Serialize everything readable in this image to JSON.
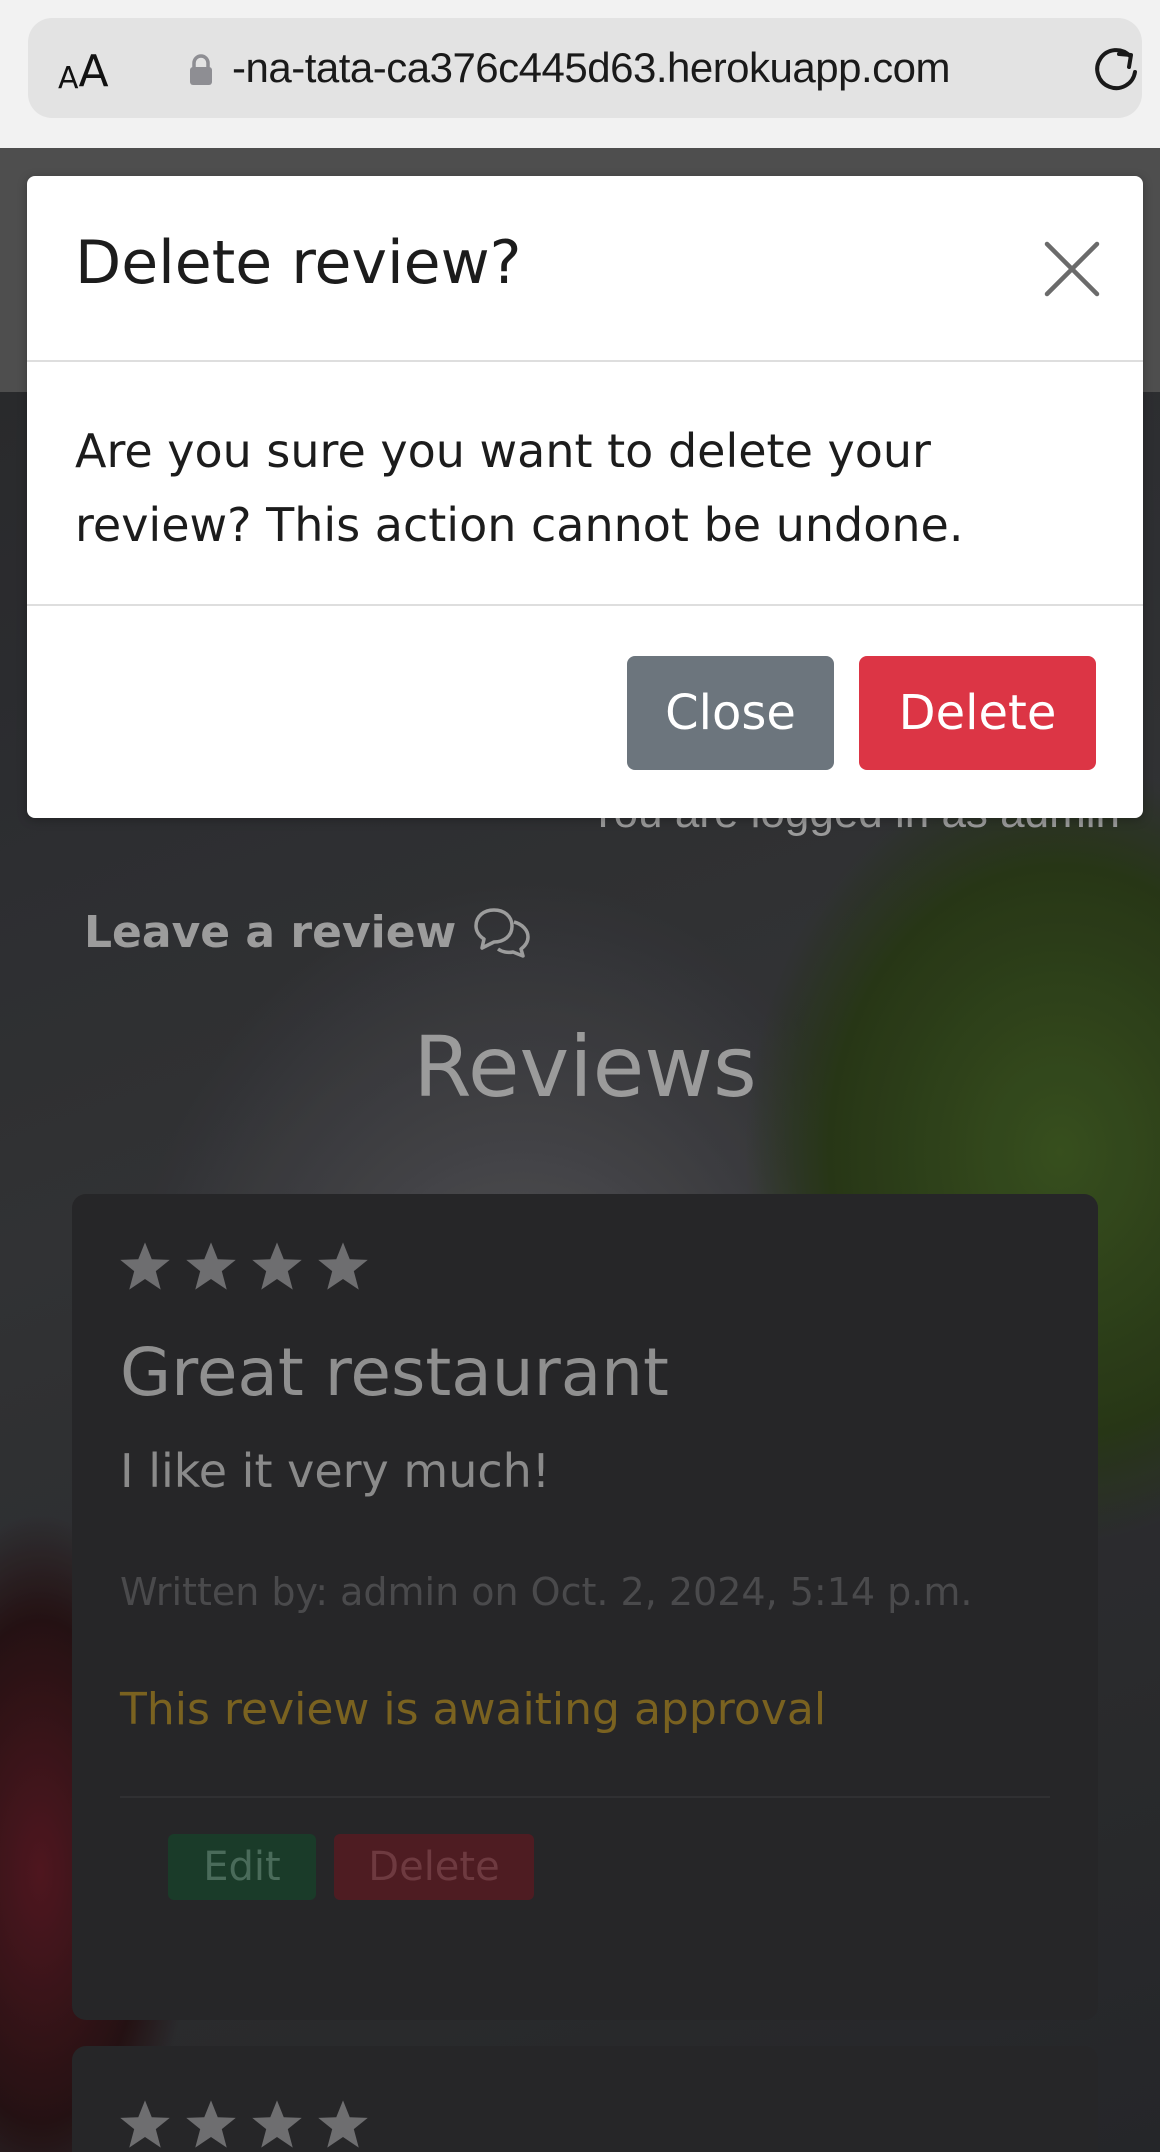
{
  "browser": {
    "text_size_small": "A",
    "text_size_large": "A",
    "url": "-na-tata-ca376c445d63.herokuapp.com"
  },
  "modal": {
    "title": "Delete review?",
    "body": "Are you sure you want to delete your review? This action cannot be undone.",
    "close_label": "Close",
    "delete_label": "Delete"
  },
  "page": {
    "logged_in_text": "You are logged in as admin",
    "leave_review_label": "Leave a review",
    "reviews_heading": "Reviews",
    "reviews": [
      {
        "rating": 4,
        "title": "Great restaurant",
        "body": "I like it very much!",
        "meta": "Written by: admin on Oct. 2, 2024, 5:14 p.m.",
        "status": "This review is awaiting approval",
        "edit_label": "Edit",
        "delete_label": "Delete"
      },
      {
        "rating": 4
      }
    ]
  },
  "colors": {
    "danger": "#dc3545",
    "secondary": "#6c757d",
    "pending": "#7a6220"
  }
}
